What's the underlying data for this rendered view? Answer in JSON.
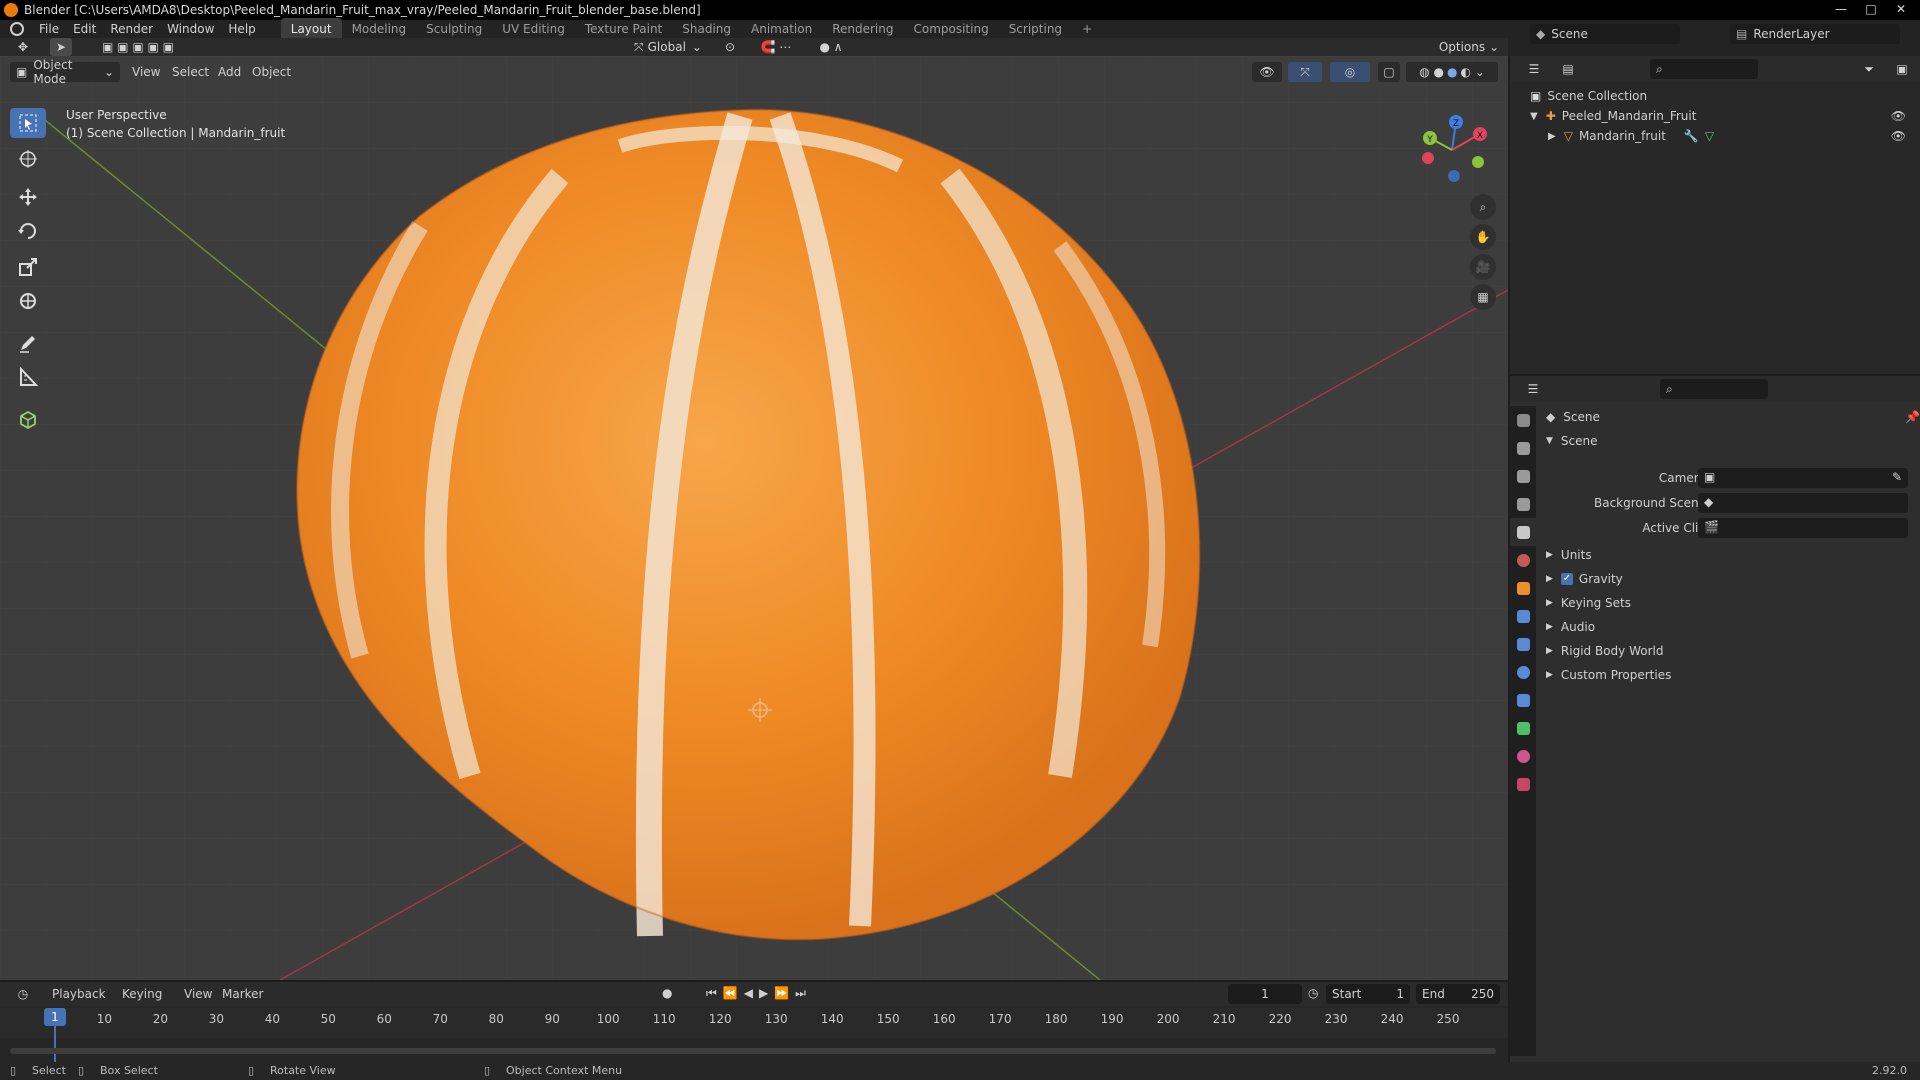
{
  "window": {
    "title": "Blender [C:\\Users\\AMDA8\\Desktop\\Peeled_Mandarin_Fruit_max_vray/Peeled_Mandarin_Fruit_blender_base.blend]"
  },
  "menu": [
    "File",
    "Edit",
    "Render",
    "Window",
    "Help"
  ],
  "workspaces": [
    "Layout",
    "Modeling",
    "Sculpting",
    "UV Editing",
    "Texture Paint",
    "Shading",
    "Animation",
    "Rendering",
    "Compositing",
    "Scripting"
  ],
  "add_workspace": "+",
  "scene_field": "Scene",
  "renderlayer_field": "RenderLayer",
  "viewport": {
    "mode": "Object Mode",
    "menus": [
      "View",
      "Select",
      "Add",
      "Object"
    ],
    "transform_orientation": "Global",
    "options": "Options",
    "perspective": "User Perspective",
    "collection_info": "(1) Scene Collection | Mandarin_fruit",
    "gizmo_axes": {
      "x": "X",
      "y": "Y",
      "z": "Z"
    }
  },
  "outliner": {
    "root": "Scene Collection",
    "items": [
      {
        "name": "Peeled_Mandarin_Fruit",
        "level": 1
      },
      {
        "name": "Mandarin_fruit",
        "level": 2
      }
    ]
  },
  "properties": {
    "header": "Scene",
    "panel": "Scene",
    "fields": [
      {
        "label": "Camera"
      },
      {
        "label": "Background Scene"
      },
      {
        "label": "Active Clip"
      }
    ],
    "subpanels": [
      "Units",
      "Gravity",
      "Keying Sets",
      "Audio",
      "Rigid Body World",
      "Custom Properties"
    ],
    "gravity_checked": true
  },
  "timeline": {
    "menus": [
      "Playback",
      "Keying",
      "View",
      "Marker"
    ],
    "current_frame": "1",
    "start_label": "Start",
    "start": "1",
    "end_label": "End",
    "end": "250",
    "ticks": [
      "1",
      "10",
      "20",
      "30",
      "40",
      "50",
      "60",
      "70",
      "80",
      "90",
      "100",
      "110",
      "120",
      "130",
      "140",
      "150",
      "160",
      "170",
      "180",
      "190",
      "200",
      "210",
      "220",
      "230",
      "240",
      "250"
    ]
  },
  "statusbar": {
    "select": "Select",
    "box_select": "Box Select",
    "rotate_view": "Rotate View",
    "context_menu": "Object Context Menu",
    "version": "2.92.0"
  },
  "colors": {
    "accent": "#4772b3",
    "fruit_orange": "#f08a24",
    "fruit_white": "#f3e6d6",
    "axis_x": "#e0435c",
    "axis_y": "#8ac43d",
    "axis_z": "#3d7ee0"
  }
}
